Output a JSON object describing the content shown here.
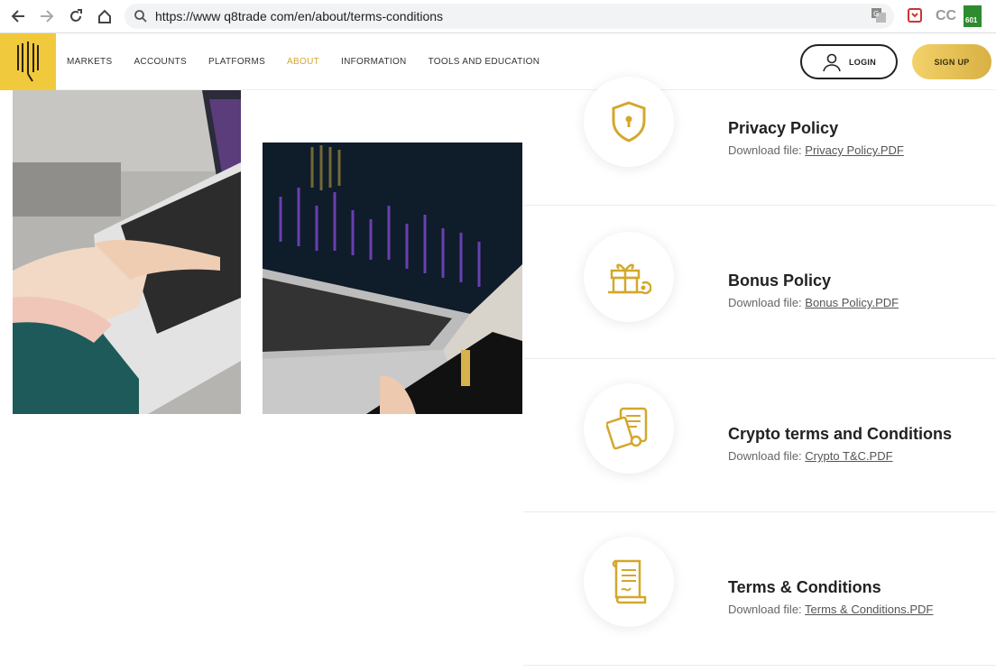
{
  "browser": {
    "url": "https://www q8trade com/en/about/terms-conditions",
    "extensions": [
      "translate-icon",
      "pocket-icon",
      "cc-icon",
      "counter-icon"
    ],
    "counter_badge": "601",
    "cc_label": "CC"
  },
  "header": {
    "menu": [
      {
        "label": "MARKETS"
      },
      {
        "label": "ACCOUNTS"
      },
      {
        "label": "PLATFORMS"
      },
      {
        "label": "ABOUT",
        "active": true
      },
      {
        "label": "INFORMATION"
      },
      {
        "label": "TOOLS AND EDUCATION"
      }
    ],
    "login_label": "LOGIN",
    "signup_label": "SIGN UP"
  },
  "colors": {
    "accent": "#d4a72c",
    "logo_bg": "#f0c93d"
  },
  "policies": [
    {
      "title": "Privacy Policy",
      "prefix": "Download file:",
      "file": "Privacy Policy.PDF",
      "icon": "shield-icon"
    },
    {
      "title": "Bonus Policy",
      "prefix": "Download file:",
      "file": "Bonus Policy.PDF",
      "icon": "gift-icon"
    },
    {
      "title": "Crypto terms and Conditions",
      "prefix": "Download file:",
      "file": "Crypto T&C.PDF",
      "icon": "certificate-icon"
    },
    {
      "title": "Terms & Conditions",
      "prefix": "Download file:",
      "file": "Terms & Conditions.PDF",
      "icon": "scroll-icon"
    }
  ]
}
